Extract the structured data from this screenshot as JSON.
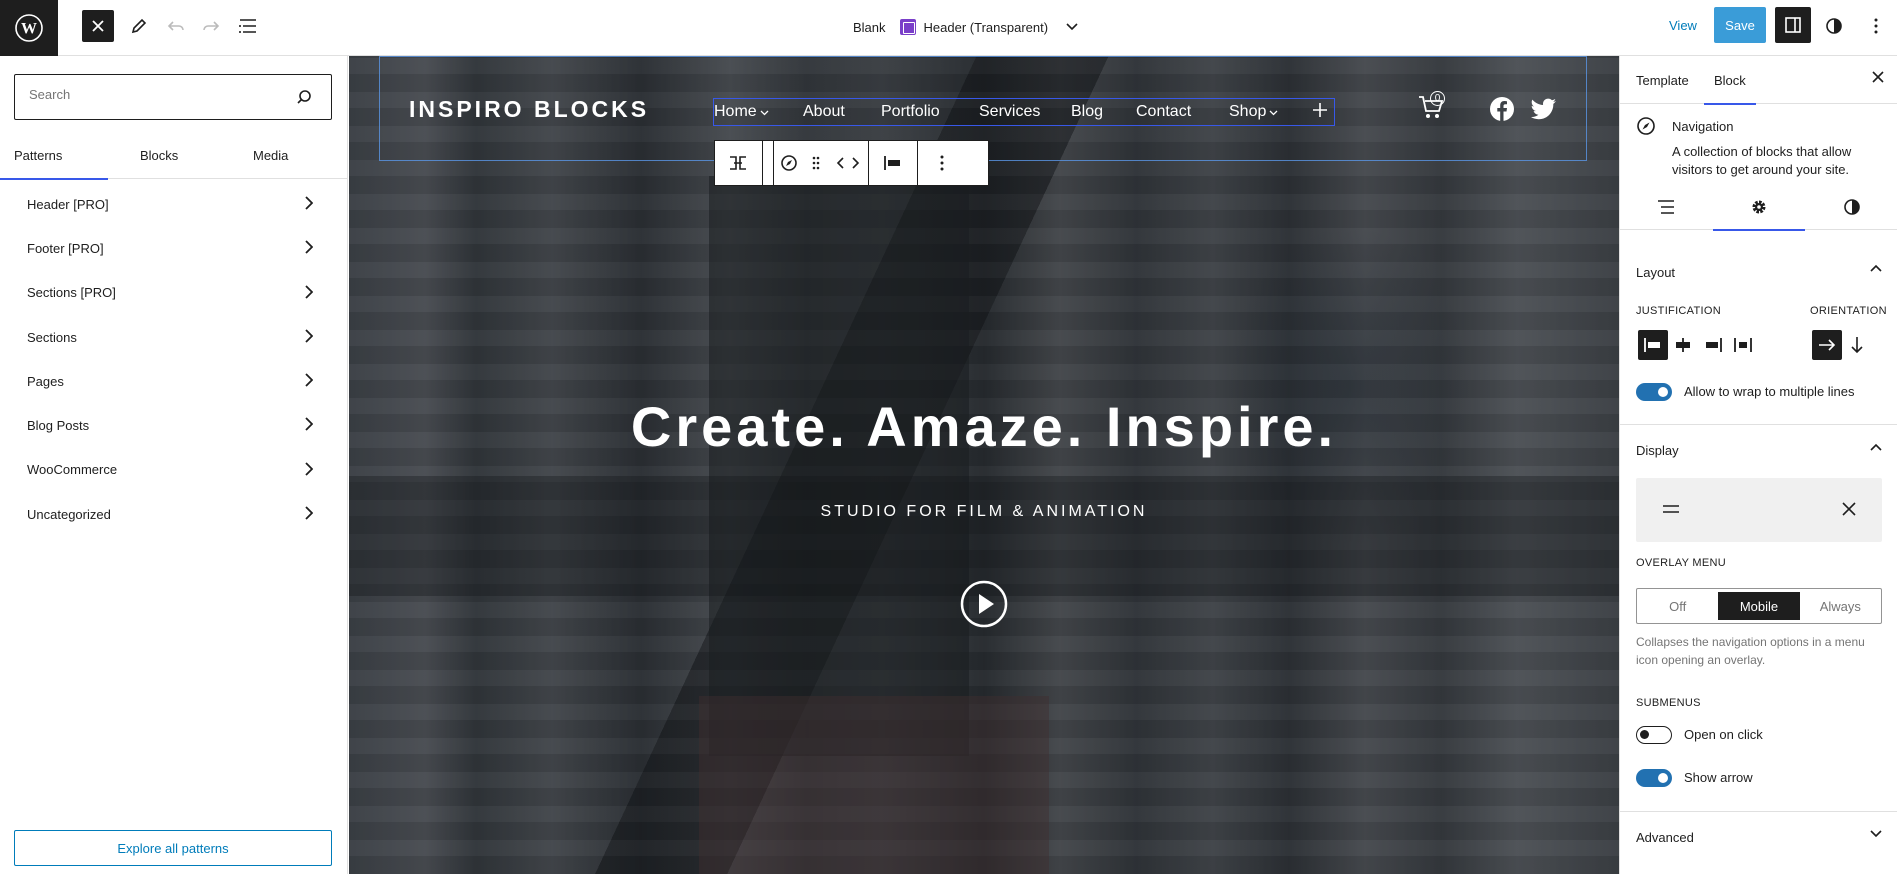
{
  "header": {
    "view_label": "View",
    "save_label": "Save",
    "doc_template": "Blank",
    "doc_part": "Header (Transparent)"
  },
  "inserter": {
    "search_placeholder": "Search",
    "tabs": [
      "Patterns",
      "Blocks",
      "Media"
    ],
    "categories": [
      "Header [PRO]",
      "Footer [PRO]",
      "Sections [PRO]",
      "Sections",
      "Pages",
      "Blog Posts",
      "WooCommerce",
      "Uncategorized"
    ],
    "explore_label": "Explore all patterns"
  },
  "canvas": {
    "site_title": "INSPIRO BLOCKS",
    "nav_items": [
      "Home",
      "About",
      "Portfolio",
      "Services",
      "Blog",
      "Contact",
      "Shop"
    ],
    "cart_count": "0",
    "hero_title": "Create. Amaze. Inspire.",
    "hero_subtitle": "STUDIO FOR FILM & ANIMATION"
  },
  "sidebar": {
    "tabs": [
      "Template",
      "Block"
    ],
    "block_name": "Navigation",
    "block_description": "A collection of blocks that allow visitors to get around your site.",
    "layout_title": "Layout",
    "justification_label": "JUSTIFICATION",
    "orientation_label": "ORIENTATION",
    "wrap_label": "Allow to wrap to multiple lines",
    "display_title": "Display",
    "overlay_menu_label": "OVERLAY MENU",
    "overlay_options": [
      "Off",
      "Mobile",
      "Always"
    ],
    "overlay_selected": "Mobile",
    "overlay_help": "Collapses the navigation options in a menu icon opening an overlay.",
    "submenus_label": "SUBMENUS",
    "open_on_click_label": "Open on click",
    "open_on_click": false,
    "show_arrow_label": "Show arrow",
    "show_arrow": true,
    "wrap_enabled": true,
    "advanced_title": "Advanced"
  },
  "colors": {
    "accent": "#3858e9",
    "save": "#3a9cd8",
    "toggle_on": "#2271b1",
    "dark": "#1e1e1e"
  }
}
